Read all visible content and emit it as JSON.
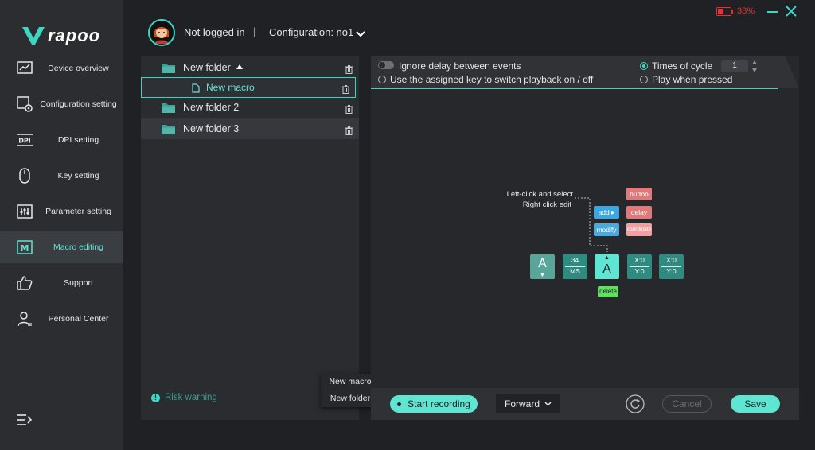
{
  "brand": {
    "logo_text": "rapoo",
    "accent": "#3dd6c3"
  },
  "header": {
    "login_status": "Not logged in",
    "separator": "|",
    "configuration": "Configuration: no1",
    "battery": {
      "level_percent": 38,
      "label": "38%",
      "color": "#e23434"
    }
  },
  "sidebar": {
    "items": [
      {
        "label": "Device overview",
        "icon": "chart-icon",
        "active": false
      },
      {
        "label": "Configuration setting",
        "icon": "config-gear-icon",
        "active": false
      },
      {
        "label": "DPI setting",
        "icon": "dpi-icon",
        "active": false
      },
      {
        "label": "Key setting",
        "icon": "mouse-icon",
        "active": false
      },
      {
        "label": "Parameter setting",
        "icon": "sliders-icon",
        "active": false
      },
      {
        "label": "Macro editing",
        "icon": "macro-icon",
        "active": true
      },
      {
        "label": "Support",
        "icon": "thumbs-up-icon",
        "active": false
      },
      {
        "label": "Personal Center",
        "icon": "user-icon",
        "active": false
      }
    ]
  },
  "tree": {
    "folders": [
      {
        "label": "New folder",
        "expanded": true
      },
      {
        "label": "New macro"
      },
      {
        "label": "New folder 2"
      },
      {
        "label": "New folder 3"
      }
    ],
    "risk_warning": "Risk warning"
  },
  "context_menu": {
    "items": [
      "New macro",
      "New folder"
    ]
  },
  "options": {
    "ignore_delay": "Ignore delay between events",
    "assigned_key": "Use the assigned key to switch playback on / off",
    "times_of_cycle": "Times of cycle",
    "cycle_value": "1",
    "play_when_pressed": "Play when pressed"
  },
  "guide": {
    "line1": "Left-click and select",
    "line2": "Right click edit",
    "add": "add",
    "modify": "modify",
    "button": "button",
    "delay": "delay",
    "coordinate": "coordinate",
    "delete": "delete",
    "keys": {
      "k1": "A",
      "k2_top": "34",
      "k2_bottom": "MS",
      "k3": "A",
      "k4_top": "X:0",
      "k4_bottom": "Y:0",
      "k5_top": "X:0",
      "k5_bottom": "Y:0"
    }
  },
  "toolbar": {
    "start_recording": "Start recording",
    "direction": "Forward",
    "cancel": "Cancel",
    "save": "Save"
  }
}
